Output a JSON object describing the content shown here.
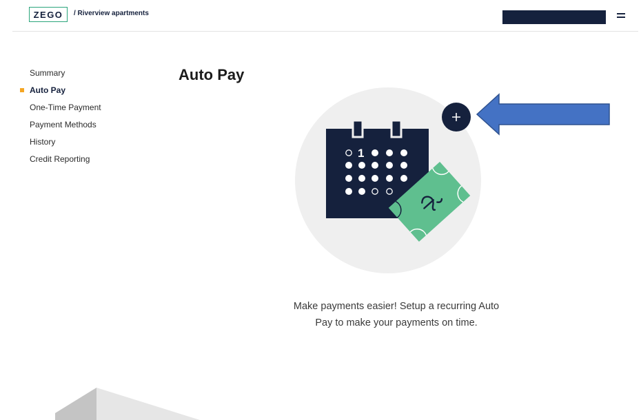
{
  "header": {
    "logo_text": "ZEGO",
    "breadcrumb": "/ Riverview apartments",
    "menu_icon": "hamburger-icon"
  },
  "sidebar": {
    "items": [
      {
        "label": "Summary",
        "active": false
      },
      {
        "label": "Auto Pay",
        "active": true
      },
      {
        "label": "One-Time Payment",
        "active": false
      },
      {
        "label": "Payment Methods",
        "active": false
      },
      {
        "label": "History",
        "active": false
      },
      {
        "label": "Credit Reporting",
        "active": false
      }
    ]
  },
  "main": {
    "title": "Auto Pay",
    "add_button_icon": "plus-icon",
    "illustration_icon": "calendar-with-cash-icon",
    "calendar_first_day": "1",
    "message_line1": "Make payments easier! Setup a recurring Auto",
    "message_line2": "Pay to make your payments on time."
  },
  "colors": {
    "navy": "#15213d",
    "green_accent": "#2aa57b",
    "cash_green": "#5fbf8f",
    "active_marker": "#f5a623",
    "annotation_arrow": "#4472c4"
  }
}
